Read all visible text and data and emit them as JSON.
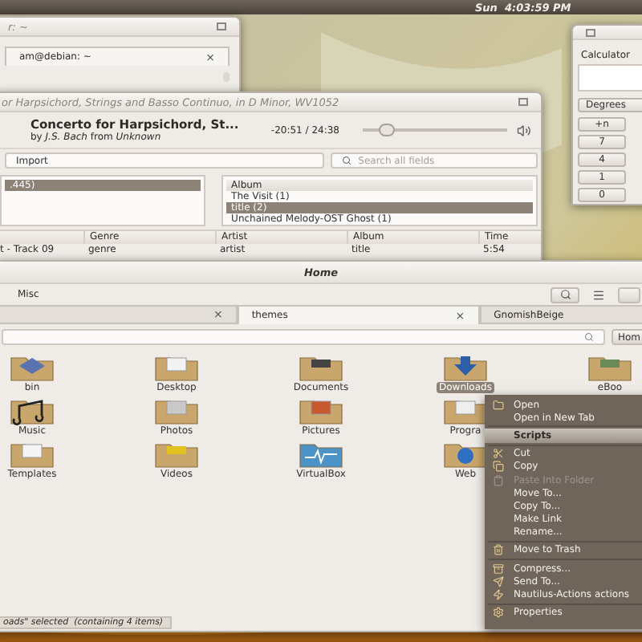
{
  "top_panel": {
    "clock": "Sun  4:03:59 PM"
  },
  "terminal": {
    "title": "r: ~",
    "tabs": [
      {
        "label": "am@debian: ~",
        "close": "×"
      }
    ]
  },
  "calculator": {
    "title": "Calculator",
    "mode": "Degrees",
    "keys": [
      "+n",
      "7",
      "4",
      "1",
      "0"
    ]
  },
  "music_player": {
    "title": "or Harpsichord, Strings and Basso Continuo, in D Minor, WV1052",
    "track": {
      "title": "Concerto for Harpsichord, St...",
      "byline": "by *J.S. Bach* from *Unknown*",
      "time": "-20:51 / 24:38",
      "level": 0.17
    },
    "import_field": {
      "value": "Import"
    },
    "search": {
      "placeholder": "Search all fields"
    },
    "collections": [
      {
        "label": ".445)",
        "selected": true
      }
    ],
    "albums": {
      "header": "Album",
      "items": [
        {
          "label": "The Visit (1)",
          "selected": false
        },
        {
          "label": "title (2)",
          "selected": true
        },
        {
          "label": "Unchained Melody-OST Ghost (1)",
          "selected": false
        }
      ]
    },
    "tracks": {
      "columns": [
        "",
        "Genre",
        "Artist",
        "Album",
        "Time"
      ],
      "rows": [
        {
          "cells": [
            "t - Track 09",
            "genre",
            "artist",
            "title",
            "5:54"
          ]
        }
      ]
    }
  },
  "file_manager": {
    "title": "Home",
    "menu": [
      "Misc"
    ],
    "tabs": [
      {
        "close": "×",
        "selected": false
      },
      {
        "label": "themes",
        "close": "×",
        "selected": true
      },
      {
        "label": "GnomishBeige",
        "selected": false
      }
    ],
    "location": {
      "button": "Hom"
    },
    "icon_rows": [
      [
        {
          "label": "bin",
          "kind": "bin",
          "selected": false
        },
        {
          "label": "Desktop",
          "kind": "desktop",
          "selected": false
        },
        {
          "label": "Documents",
          "kind": "documents",
          "selected": false
        },
        {
          "label": "Downloads",
          "kind": "downloads",
          "selected": true
        },
        {
          "label": "eBoo",
          "kind": "books",
          "selected": false
        }
      ],
      [
        {
          "label": "Music",
          "kind": "music",
          "selected": false
        },
        {
          "label": "Photos",
          "kind": "photos",
          "selected": false
        },
        {
          "label": "Pictures",
          "kind": "pictures",
          "selected": false
        },
        {
          "label": "Progra",
          "kind": "programs",
          "selected": false
        }
      ],
      [
        {
          "label": "Templates",
          "kind": "templates",
          "selected": false
        },
        {
          "label": "Videos",
          "kind": "videos",
          "selected": false
        },
        {
          "label": "VirtualBox",
          "kind": "virtualbox",
          "selected": false
        },
        {
          "label": "Web",
          "kind": "web",
          "selected": false
        }
      ]
    ],
    "status": "oads\" selected  (containing 4 items)"
  },
  "context_menu": {
    "groups": [
      [
        {
          "label": "Open",
          "kind": "folder"
        },
        {
          "label": "Open in New Tab",
          "kind": "plain"
        }
      ],
      [
        {
          "label": "Scripts",
          "kind": "plain",
          "selected": true
        }
      ],
      [
        {
          "label": "Cut",
          "kind": "cut"
        },
        {
          "label": "Copy",
          "kind": "copy"
        },
        {
          "label": "Paste Into Folder",
          "kind": "paste",
          "disabled": true
        },
        {
          "label": "Move To...",
          "kind": "plain"
        },
        {
          "label": "Copy To...",
          "kind": "plain"
        },
        {
          "label": "Make Link",
          "kind": "plain"
        },
        {
          "label": "Rename...",
          "kind": "plain"
        }
      ],
      [
        {
          "label": "Move to Trash",
          "kind": "trash"
        }
      ],
      [
        {
          "label": "Compress...",
          "kind": "archive"
        },
        {
          "label": "Send To...",
          "kind": "send"
        },
        {
          "label": "Nautilus-Actions actions",
          "kind": "actions"
        }
      ],
      [
        {
          "label": "Properties",
          "kind": "gear"
        }
      ]
    ]
  }
}
